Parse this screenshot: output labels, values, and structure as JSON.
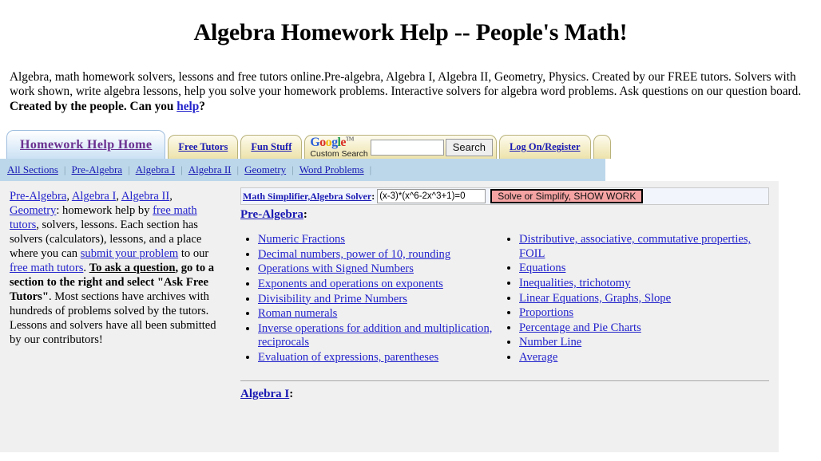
{
  "header": {
    "title": "Algebra Homework Help -- People's Math!",
    "intro_part1": "Algebra, math homework solvers, lessons and free tutors online.Pre-algebra, Algebra I, Algebra II, Geometry, Physics. Created by our FREE tutors. Solvers with work shown, write algebra lessons, help you solve your homework problems. Interactive solvers for algebra word problems. Ask questions on our question board. ",
    "intro_bold": "Created by the people. Can you ",
    "intro_link": "help",
    "intro_end": "?"
  },
  "tabs": [
    {
      "label": "Homework Help Home",
      "active": true
    },
    {
      "label": "Free Tutors",
      "active": false
    },
    {
      "label": "Fun Stuff",
      "active": false
    }
  ],
  "google_search": {
    "logo_letters": [
      "G",
      "o",
      "o",
      "g",
      "l",
      "e"
    ],
    "trademark": "TM",
    "subtitle": "Custom Search",
    "input_value": "",
    "button_label": "Search"
  },
  "account_tab": {
    "label": "Log On/Register"
  },
  "subnav": {
    "items": [
      "All Sections",
      "Pre-Algebra",
      "Algebra I",
      "Algebra II",
      "Geometry",
      "Word Problems"
    ],
    "separator": "|"
  },
  "sidebar": {
    "links_inline": [
      "Pre-Algebra",
      "Algebra I",
      "Algebra II",
      "Geometry"
    ],
    "text_1": ": homework help by ",
    "link_free_math_tutors_1": "free math tutors",
    "text_2": ", solvers, lessons. Each section has solvers (calculators), lessons, and a place where you can ",
    "link_submit": "submit your problem",
    "text_3": " to our ",
    "link_free_math_tutors_2": "free math tutors",
    "text_4": ". ",
    "bold_1": "To ask a question",
    "bold_2": ", go to a section to the right and select \"Ask Free Tutors\"",
    "text_5": ". Most sections have archives with hundreds of problems solved by the tutors. Lessons and solvers have all been submitted by our contributors!"
  },
  "solver": {
    "label_link": "Math Simplifier,Algebra Solver",
    "label_colon": ":",
    "input_value": "(x-3)*(x^6-2x^3+1)=0",
    "input_placeholder": "",
    "button_label": "Solve or Simplify, SHOW WORK"
  },
  "sections": [
    {
      "heading": "Pre-Algebra",
      "heading_colon": ":",
      "left_links": [
        "Numeric Fractions",
        "Decimal numbers, power of 10, rounding",
        "Operations with Signed Numbers",
        "Exponents and operations on exponents",
        "Divisibility and Prime Numbers",
        "Roman numerals",
        "Inverse operations for addition and multiplication, reciprocals",
        "Evaluation of expressions, parentheses"
      ],
      "right_links": [
        "Distributive, associative, commutative properties, FOIL",
        "Equations",
        "Inequalities, trichotomy",
        "Linear Equations, Graphs, Slope",
        "Proportions",
        "Percentage and Pie Charts",
        "Number Line",
        "Average"
      ]
    },
    {
      "heading": "Algebra I",
      "heading_colon": ":",
      "left_links": [],
      "right_links": []
    }
  ],
  "colors": {
    "link": "#2222cc",
    "nav_link": "#1919b3",
    "active_tab_text": "#6a2f8f",
    "subnav_bg": "#bcd7ea",
    "content_bg": "#f0f0f0",
    "solver_button_bg": "#f5a3a3"
  }
}
